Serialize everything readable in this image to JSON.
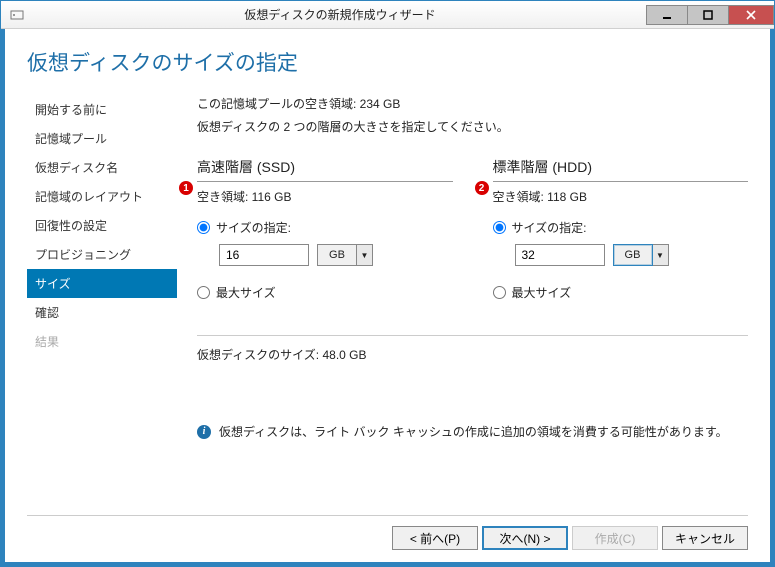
{
  "window": {
    "title": "仮想ディスクの新規作成ウィザード"
  },
  "page_title": "仮想ディスクのサイズの指定",
  "sidebar": {
    "steps": [
      {
        "label": "開始する前に",
        "state": "link"
      },
      {
        "label": "記憶域プール",
        "state": "link"
      },
      {
        "label": "仮想ディスク名",
        "state": "link"
      },
      {
        "label": "記憶域のレイアウト",
        "state": "link"
      },
      {
        "label": "回復性の設定",
        "state": "link"
      },
      {
        "label": "プロビジョニング",
        "state": "link"
      },
      {
        "label": "サイズ",
        "state": "active"
      },
      {
        "label": "確認",
        "state": "link"
      },
      {
        "label": "結果",
        "state": "disabled"
      }
    ]
  },
  "main": {
    "pool_free": "この記憶域プールの空き領域: 234 GB",
    "instruction": "仮想ディスクの 2 つの階層の大きさを指定してください。",
    "tiers": [
      {
        "badge": "1",
        "heading": "高速階層 (SSD)",
        "free": "空き領域: 116 GB",
        "specify_label": "サイズの指定:",
        "specify_checked": true,
        "value": "16",
        "unit": "GB",
        "unit_highlight": false,
        "max_label": "最大サイズ",
        "max_checked": false
      },
      {
        "badge": "2",
        "heading": "標準階層 (HDD)",
        "free": "空き領域: 118 GB",
        "specify_label": "サイズの指定:",
        "specify_checked": true,
        "value": "32",
        "unit": "GB",
        "unit_highlight": true,
        "max_label": "最大サイズ",
        "max_checked": false
      }
    ],
    "total": "仮想ディスクのサイズ: 48.0 GB",
    "note": "仮想ディスクは、ライト バック キャッシュの作成に追加の領域を消費する可能性があります。"
  },
  "footer": {
    "prev": "< 前へ(P)",
    "next": "次へ(N) >",
    "create": "作成(C)",
    "cancel": "キャンセル"
  }
}
